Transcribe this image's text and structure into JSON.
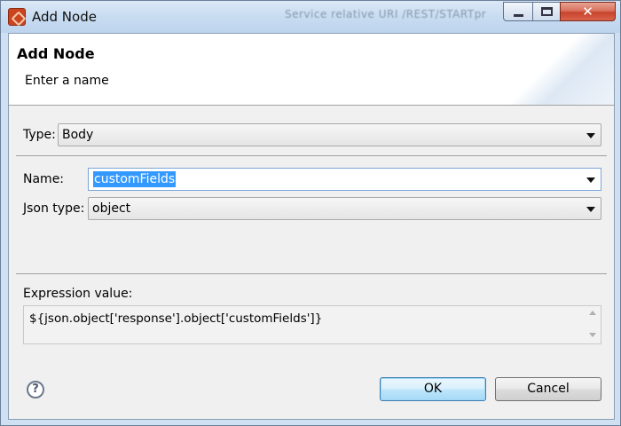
{
  "window": {
    "title": "Add Node",
    "background_window_text": "Service relative URI    /REST/STARTpr"
  },
  "header": {
    "title": "Add Node",
    "subtitle": "Enter a name"
  },
  "form": {
    "type_label": "Type:",
    "type_value": "Body",
    "name_label": "Name:",
    "name_value": "customFields",
    "json_type_label": "Json type:",
    "json_type_value": "object",
    "expression_label": "Expression value:",
    "expression_value": "${json.object['response'].object['customFields']}"
  },
  "buttons": {
    "help_glyph": "?",
    "ok_label": "OK",
    "cancel_label": "Cancel",
    "close_glyph": "✕"
  },
  "colors": {
    "selection": "#3399ff",
    "close_button": "#c9442c",
    "default_button": "#bee6fd"
  },
  "icons": [
    "app-icon",
    "minimize-icon",
    "maximize-icon",
    "close-icon",
    "dropdown-arrow-icon",
    "help-icon",
    "scroll-up-icon",
    "scroll-down-icon"
  ]
}
